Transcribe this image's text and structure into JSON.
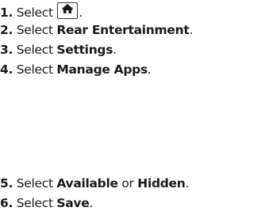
{
  "steps": [
    {
      "num": "1.",
      "pre": "Select",
      "post": "."
    },
    {
      "num": "2.",
      "pre": "Select",
      "bold": "Rear Entertainment",
      "post": "."
    },
    {
      "num": "3.",
      "pre": "Select",
      "bold": "Settings",
      "post": "."
    },
    {
      "num": "4.",
      "pre": "Select",
      "bold": "Manage Apps",
      "post": "."
    },
    {
      "num": "5.",
      "pre": "Select",
      "bold": "Available",
      "mid": "or",
      "bold2": "Hidden",
      "post": "."
    },
    {
      "num": "6.",
      "pre": "Select",
      "bold": "Save",
      "post": "."
    }
  ],
  "home_key": {
    "label": "HOME",
    "icon": "home-icon"
  }
}
